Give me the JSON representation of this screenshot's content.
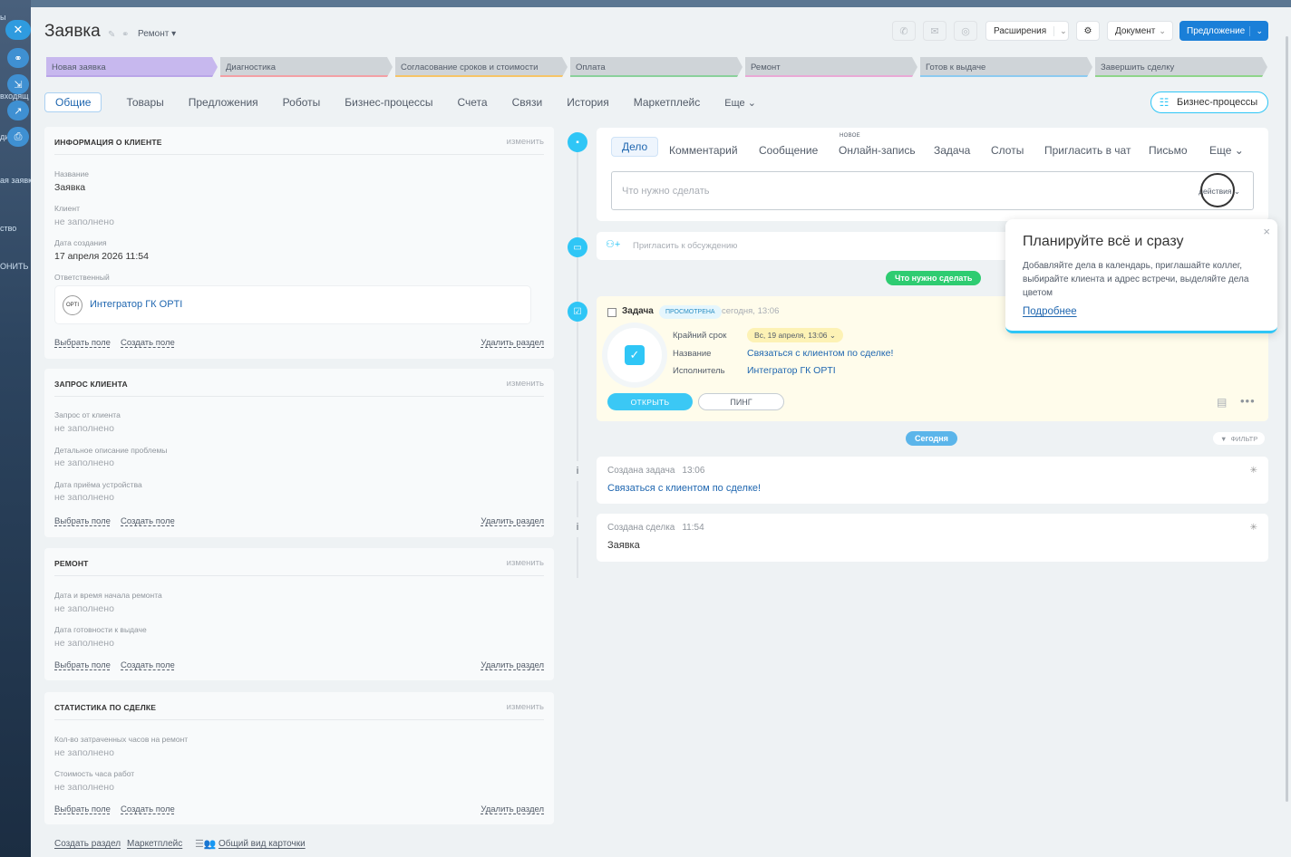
{
  "background": {
    "fragments": [
      "ы",
      "входящ",
      "ди",
      "ая заявк",
      "ство",
      "ОНИТЬ"
    ]
  },
  "side_buttons": [
    {
      "name": "close-icon",
      "glyph": "✕"
    },
    {
      "name": "link-icon",
      "glyph": "⚭"
    },
    {
      "name": "download-icon",
      "glyph": "⇲"
    },
    {
      "name": "external-link-icon",
      "glyph": "↗"
    },
    {
      "name": "print-icon",
      "glyph": "⎙"
    }
  ],
  "header": {
    "title": "Заявка",
    "category": "Ремонт ▾",
    "extensions_label": "Расширения",
    "document_label": "Документ",
    "offer_label": "Предложение",
    "dropdown_glyph": "⌄"
  },
  "stages": [
    {
      "label": "Новая заявка",
      "color": "#c7b8ee"
    },
    {
      "label": "Диагностика",
      "color": "#cfd4d8"
    },
    {
      "label": "Согласование сроков и стоимости",
      "color": "#cfd4d8"
    },
    {
      "label": "Оплата",
      "color": "#cfd4d8"
    },
    {
      "label": "Ремонт",
      "color": "#cfd4d8"
    },
    {
      "label": "Готов к выдаче",
      "color": "#cfd4d8"
    },
    {
      "label": "Завершить сделку",
      "color": "#cfd4d8"
    }
  ],
  "stage_accents": [
    "#b9a5e8",
    "#f3a0a5",
    "#f6c567",
    "#8ad19b",
    "#e9a9d6",
    "#8ccbf0",
    "#8fd58a"
  ],
  "tabs": [
    "Общие",
    "Товары",
    "Предложения",
    "Роботы",
    "Бизнес-процессы",
    "Счета",
    "Связи",
    "История",
    "Маркетплейс",
    "Еще ⌄"
  ],
  "bp_button": "Бизнес-процессы",
  "cards": {
    "client": {
      "title": "ИНФОРМАЦИЯ О КЛИЕНТЕ",
      "change": "изменить",
      "name_label": "Название",
      "name_value": "Заявка",
      "client_label": "Клиент",
      "client_value": "не заполнено",
      "date_label": "Дата создания",
      "date_value": "17 апреля 2026 11:54",
      "resp_label": "Ответственный",
      "resp_name": "Интегратор ГК OPTI",
      "avatar_text": "OPTI"
    },
    "request": {
      "title": "ЗАПРОС КЛИЕНТА",
      "change": "изменить",
      "f1_label": "Запрос от клиента",
      "f1_value": "не заполнено",
      "f2_label": "Детальное описание проблемы",
      "f2_value": "не заполнено",
      "f3_label": "Дата приёма устройства",
      "f3_value": "не заполнено"
    },
    "repair": {
      "title": "РЕМОНТ",
      "change": "изменить",
      "f1_label": "Дата и время начала ремонта",
      "f1_value": "не заполнено",
      "f2_label": "Дата готовности к выдаче",
      "f2_value": "не заполнено"
    },
    "stats": {
      "title": "СТАТИСТИКА ПО СДЕЛКЕ",
      "change": "изменить",
      "f1_label": "Кол-во затраченных часов на ремонт",
      "f1_value": "не заполнено",
      "f2_label": "Стоимость часа работ",
      "f2_value": "не заполнено"
    },
    "select_field": "Выбрать поле",
    "create_field": "Создать поле",
    "delete_section": "Удалить раздел"
  },
  "footer": {
    "create_section": "Создать раздел",
    "marketplace": "Маркетплейс",
    "common_view": "Общий вид карточки"
  },
  "editor": {
    "tabs": [
      "Дело",
      "Комментарий",
      "Сообщение",
      "Онлайн-запись",
      "Задача",
      "Слоты",
      "Пригласить в чат",
      "Письмо",
      "Еще ⌄"
    ],
    "new_badge": "НОВОЕ",
    "placeholder": "Что нужно сделать",
    "actions": "действия ⌄"
  },
  "invite": "Пригласить к обсуждению",
  "todo_pill": "Что нужно сделать",
  "task": {
    "title": "Задача",
    "viewed": "ПРОСМОТРЕНА",
    "time": "сегодня, 13:06",
    "deadline_label": "Крайний срок",
    "deadline_value": "Вс, 19 апреля, 13:06 ⌄",
    "name_label": "Название",
    "name_value": "Связаться с клиентом по сделке!",
    "exec_label": "Исполнитель",
    "exec_value": "Интегратор ГК OPTI",
    "open": "ОТКРЫТЬ",
    "ping": "ПИНГ"
  },
  "today_pill": "Сегодня",
  "filter": "ФИЛЬТР",
  "history": [
    {
      "title": "Создана задача",
      "time": "13:06",
      "value": "Связаться с клиентом по сделке!",
      "link": true
    },
    {
      "title": "Создана сделка",
      "time": "11:54",
      "value": "Заявка",
      "link": false
    }
  ],
  "popup": {
    "title": "Планируйте всё и сразу",
    "text": "Добавляйте дела в календарь, приглашайте коллег, выбирайте клиента и адрес встречи, выделяйте дела цветом",
    "link": "Подробнее"
  },
  "colors": {
    "accent": "#2fc6f6",
    "primary": "#1a7fd8",
    "link": "#2067b0",
    "todo_green": "#2ecc71"
  }
}
